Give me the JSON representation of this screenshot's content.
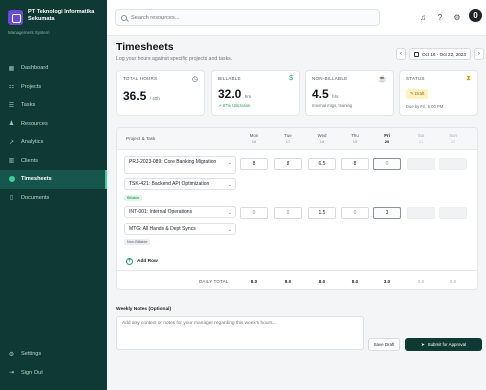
{
  "brand": {
    "name": "PT Teknologi Informatika Sekumata",
    "subtitle": "Management System"
  },
  "sidebar": {
    "items": [
      {
        "label": "Dashboard",
        "icon": "grid-icon"
      },
      {
        "label": "Projects",
        "icon": "projects-icon"
      },
      {
        "label": "Tasks",
        "icon": "tasks-icon"
      },
      {
        "label": "Resources",
        "icon": "users-icon"
      },
      {
        "label": "Analytics",
        "icon": "analytics-icon"
      },
      {
        "label": "Clients",
        "icon": "clients-icon"
      },
      {
        "label": "Timesheets",
        "icon": "clock-icon",
        "active": true
      },
      {
        "label": "Documents",
        "icon": "document-icon"
      }
    ],
    "bottom": [
      {
        "label": "Settings",
        "icon": "gear-icon"
      },
      {
        "label": "Sign Out",
        "icon": "sign-out-icon"
      }
    ]
  },
  "search": {
    "placeholder": "Search resources..."
  },
  "user": {
    "initial": "0"
  },
  "page": {
    "title": "Timesheets",
    "subtitle": "Log your hours against specific projects and tasks."
  },
  "date_range": "Oct 16 - Oct 22, 2023",
  "cards": {
    "total": {
      "label": "TOTAL HOURS",
      "value": "36.5",
      "unit": "/ 40h"
    },
    "billable": {
      "label": "BILLABLE",
      "value": "32.0",
      "unit": "hrs",
      "note": "↗ 87% Utilization"
    },
    "nonbillable": {
      "label": "NON-BILLABLE",
      "value": "4.5",
      "unit": "hrs",
      "note": "Internal mtgs, training"
    },
    "status": {
      "label": "STATUS",
      "badge": "✎ Draft",
      "note": "Due by Fri, 5:00 PM"
    }
  },
  "table": {
    "task_header": "Project & Task",
    "days": [
      {
        "name": "Mon",
        "date": "16"
      },
      {
        "name": "Tue",
        "date": "17"
      },
      {
        "name": "Wed",
        "date": "18"
      },
      {
        "name": "Thu",
        "date": "19"
      },
      {
        "name": "Fri",
        "date": "20"
      },
      {
        "name": "Sat",
        "date": "21"
      },
      {
        "name": "Sun",
        "date": "22"
      }
    ],
    "rows": [
      {
        "project": "PRJ-2023-089: Core Banking Migration",
        "task": "TSK-421: Backend API Optimization",
        "tag": "Billable",
        "hours": [
          "8",
          "8",
          "6.5",
          "8",
          "0",
          "",
          ""
        ]
      },
      {
        "project": "INT-001: Internal Operations",
        "task": "MTG: All Hands & Dept Syncs",
        "tag": "Non-Billable",
        "hours": [
          "0",
          "0",
          "1.5",
          "0",
          "3",
          "",
          ""
        ]
      }
    ],
    "add_row": "Add Row",
    "total_label": "DAILY TOTAL",
    "totals": [
      "8.0",
      "8.0",
      "8.0",
      "8.0",
      "3.0",
      "0.0",
      "0.0"
    ]
  },
  "notes": {
    "label": "Weekly Notes (Optional)",
    "placeholder": "Add any context or notes for your manager regarding this week's hours..."
  },
  "actions": {
    "save": "Save Draft",
    "submit": "Submit for Approval"
  }
}
